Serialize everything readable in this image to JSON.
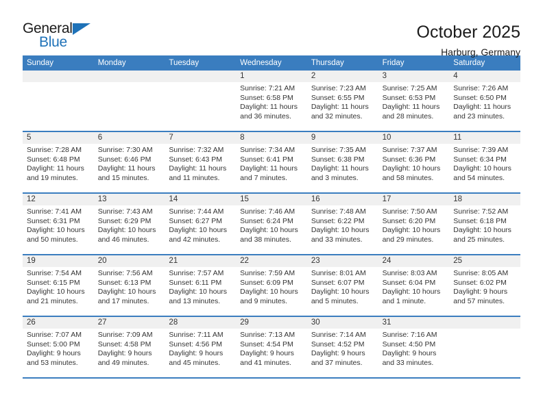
{
  "brand": {
    "name_part1": "General",
    "name_part2": "Blue",
    "accent_color": "#1f72b8"
  },
  "header": {
    "title": "October 2025",
    "location": "Harburg, Germany"
  },
  "calendar": {
    "header_color": "#3a7dbf",
    "weekdays": [
      "Sunday",
      "Monday",
      "Tuesday",
      "Wednesday",
      "Thursday",
      "Friday",
      "Saturday"
    ],
    "weeks": [
      [
        {
          "day": "",
          "lines": []
        },
        {
          "day": "",
          "lines": []
        },
        {
          "day": "",
          "lines": []
        },
        {
          "day": "1",
          "lines": [
            "Sunrise: 7:21 AM",
            "Sunset: 6:58 PM",
            "Daylight: 11 hours",
            "and 36 minutes."
          ]
        },
        {
          "day": "2",
          "lines": [
            "Sunrise: 7:23 AM",
            "Sunset: 6:55 PM",
            "Daylight: 11 hours",
            "and 32 minutes."
          ]
        },
        {
          "day": "3",
          "lines": [
            "Sunrise: 7:25 AM",
            "Sunset: 6:53 PM",
            "Daylight: 11 hours",
            "and 28 minutes."
          ]
        },
        {
          "day": "4",
          "lines": [
            "Sunrise: 7:26 AM",
            "Sunset: 6:50 PM",
            "Daylight: 11 hours",
            "and 23 minutes."
          ]
        }
      ],
      [
        {
          "day": "5",
          "lines": [
            "Sunrise: 7:28 AM",
            "Sunset: 6:48 PM",
            "Daylight: 11 hours",
            "and 19 minutes."
          ]
        },
        {
          "day": "6",
          "lines": [
            "Sunrise: 7:30 AM",
            "Sunset: 6:46 PM",
            "Daylight: 11 hours",
            "and 15 minutes."
          ]
        },
        {
          "day": "7",
          "lines": [
            "Sunrise: 7:32 AM",
            "Sunset: 6:43 PM",
            "Daylight: 11 hours",
            "and 11 minutes."
          ]
        },
        {
          "day": "8",
          "lines": [
            "Sunrise: 7:34 AM",
            "Sunset: 6:41 PM",
            "Daylight: 11 hours",
            "and 7 minutes."
          ]
        },
        {
          "day": "9",
          "lines": [
            "Sunrise: 7:35 AM",
            "Sunset: 6:38 PM",
            "Daylight: 11 hours",
            "and 3 minutes."
          ]
        },
        {
          "day": "10",
          "lines": [
            "Sunrise: 7:37 AM",
            "Sunset: 6:36 PM",
            "Daylight: 10 hours",
            "and 58 minutes."
          ]
        },
        {
          "day": "11",
          "lines": [
            "Sunrise: 7:39 AM",
            "Sunset: 6:34 PM",
            "Daylight: 10 hours",
            "and 54 minutes."
          ]
        }
      ],
      [
        {
          "day": "12",
          "lines": [
            "Sunrise: 7:41 AM",
            "Sunset: 6:31 PM",
            "Daylight: 10 hours",
            "and 50 minutes."
          ]
        },
        {
          "day": "13",
          "lines": [
            "Sunrise: 7:43 AM",
            "Sunset: 6:29 PM",
            "Daylight: 10 hours",
            "and 46 minutes."
          ]
        },
        {
          "day": "14",
          "lines": [
            "Sunrise: 7:44 AM",
            "Sunset: 6:27 PM",
            "Daylight: 10 hours",
            "and 42 minutes."
          ]
        },
        {
          "day": "15",
          "lines": [
            "Sunrise: 7:46 AM",
            "Sunset: 6:24 PM",
            "Daylight: 10 hours",
            "and 38 minutes."
          ]
        },
        {
          "day": "16",
          "lines": [
            "Sunrise: 7:48 AM",
            "Sunset: 6:22 PM",
            "Daylight: 10 hours",
            "and 33 minutes."
          ]
        },
        {
          "day": "17",
          "lines": [
            "Sunrise: 7:50 AM",
            "Sunset: 6:20 PM",
            "Daylight: 10 hours",
            "and 29 minutes."
          ]
        },
        {
          "day": "18",
          "lines": [
            "Sunrise: 7:52 AM",
            "Sunset: 6:18 PM",
            "Daylight: 10 hours",
            "and 25 minutes."
          ]
        }
      ],
      [
        {
          "day": "19",
          "lines": [
            "Sunrise: 7:54 AM",
            "Sunset: 6:15 PM",
            "Daylight: 10 hours",
            "and 21 minutes."
          ]
        },
        {
          "day": "20",
          "lines": [
            "Sunrise: 7:56 AM",
            "Sunset: 6:13 PM",
            "Daylight: 10 hours",
            "and 17 minutes."
          ]
        },
        {
          "day": "21",
          "lines": [
            "Sunrise: 7:57 AM",
            "Sunset: 6:11 PM",
            "Daylight: 10 hours",
            "and 13 minutes."
          ]
        },
        {
          "day": "22",
          "lines": [
            "Sunrise: 7:59 AM",
            "Sunset: 6:09 PM",
            "Daylight: 10 hours",
            "and 9 minutes."
          ]
        },
        {
          "day": "23",
          "lines": [
            "Sunrise: 8:01 AM",
            "Sunset: 6:07 PM",
            "Daylight: 10 hours",
            "and 5 minutes."
          ]
        },
        {
          "day": "24",
          "lines": [
            "Sunrise: 8:03 AM",
            "Sunset: 6:04 PM",
            "Daylight: 10 hours",
            "and 1 minute."
          ]
        },
        {
          "day": "25",
          "lines": [
            "Sunrise: 8:05 AM",
            "Sunset: 6:02 PM",
            "Daylight: 9 hours",
            "and 57 minutes."
          ]
        }
      ],
      [
        {
          "day": "26",
          "lines": [
            "Sunrise: 7:07 AM",
            "Sunset: 5:00 PM",
            "Daylight: 9 hours",
            "and 53 minutes."
          ]
        },
        {
          "day": "27",
          "lines": [
            "Sunrise: 7:09 AM",
            "Sunset: 4:58 PM",
            "Daylight: 9 hours",
            "and 49 minutes."
          ]
        },
        {
          "day": "28",
          "lines": [
            "Sunrise: 7:11 AM",
            "Sunset: 4:56 PM",
            "Daylight: 9 hours",
            "and 45 minutes."
          ]
        },
        {
          "day": "29",
          "lines": [
            "Sunrise: 7:13 AM",
            "Sunset: 4:54 PM",
            "Daylight: 9 hours",
            "and 41 minutes."
          ]
        },
        {
          "day": "30",
          "lines": [
            "Sunrise: 7:14 AM",
            "Sunset: 4:52 PM",
            "Daylight: 9 hours",
            "and 37 minutes."
          ]
        },
        {
          "day": "31",
          "lines": [
            "Sunrise: 7:16 AM",
            "Sunset: 4:50 PM",
            "Daylight: 9 hours",
            "and 33 minutes."
          ]
        },
        {
          "day": "",
          "lines": []
        }
      ]
    ]
  }
}
